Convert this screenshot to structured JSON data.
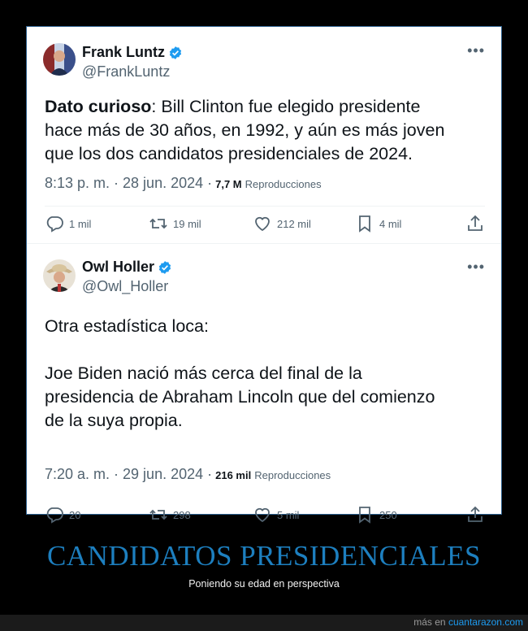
{
  "tweets": [
    {
      "name": "Frank Luntz",
      "handle": "@FrankLuntz",
      "text_bold": "Dato curioso",
      "text_rest": ": Bill Clinton fue elegido presidente\nhace más de 30 años, en 1992, y aún es más joven\nque los dos candidatos presidenciales de 2024.",
      "timestamp": "8:13 p. m. · 28 jun. 2024 ·",
      "views_count": "7,7 M",
      "views_label": "Reproducciones",
      "replies": "1 mil",
      "retweets": "19 mil",
      "likes": "212 mil",
      "bookmarks": "4 mil"
    },
    {
      "name": "Owl Holler",
      "handle": "@Owl_Holler",
      "text": "Otra estadística loca:\n\nJoe Biden nació más cerca del final de la\npresidencia de Abraham Lincoln que del comienzo\nde la suya propia.",
      "timestamp": "7:20 a. m. · 29 jun. 2024 ·",
      "views_count": "216 mil",
      "views_label": "Reproducciones",
      "replies": "20",
      "retweets": "298",
      "likes": "5 mil",
      "bookmarks": "250"
    }
  ],
  "caption": {
    "title": "CANDIDATOS PRESIDENCIALES",
    "subtitle": "Poniendo su edad en perspectiva"
  },
  "footer": {
    "prefix": "más en",
    "site": "cuantarazon.com"
  },
  "colors": {
    "verified": "#1d9bf0",
    "caption_title": "#1d7fbf",
    "icon_gray": "#536471"
  },
  "icons": [
    "more-icon",
    "verified-icon",
    "reply-icon",
    "retweet-icon",
    "like-icon",
    "bookmark-icon",
    "share-icon"
  ]
}
